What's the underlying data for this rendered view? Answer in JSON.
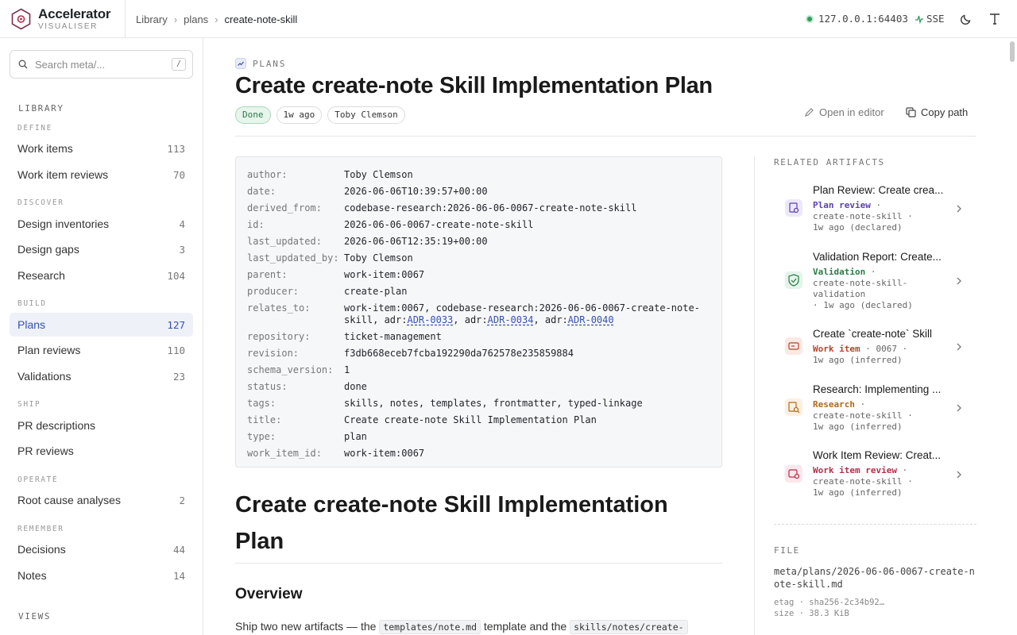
{
  "brand": {
    "name": "Accelerator",
    "subtitle": "VISUALISER"
  },
  "breadcrumb": {
    "items": [
      "Library",
      "plans"
    ],
    "current": "create-note-skill"
  },
  "server": {
    "address": "127.0.0.1:64403",
    "transport": "SSE",
    "status_color": "#2e9e5a"
  },
  "icons": {
    "logo": "hexagon-logo-icon",
    "theme": "moon-icon",
    "font": "text-size-icon"
  },
  "search": {
    "placeholder": "Search meta/...",
    "shortcut": "/"
  },
  "sidebar": {
    "title": "LIBRARY",
    "groups": [
      {
        "label": "DEFINE",
        "items": [
          {
            "label": "Work items",
            "count": "113"
          },
          {
            "label": "Work item reviews",
            "count": "70"
          }
        ]
      },
      {
        "label": "DISCOVER",
        "items": [
          {
            "label": "Design inventories",
            "count": "4"
          },
          {
            "label": "Design gaps",
            "count": "3"
          },
          {
            "label": "Research",
            "count": "104"
          }
        ]
      },
      {
        "label": "BUILD",
        "items": [
          {
            "label": "Plans",
            "count": "127",
            "active": true
          },
          {
            "label": "Plan reviews",
            "count": "110"
          },
          {
            "label": "Validations",
            "count": "23"
          }
        ]
      },
      {
        "label": "SHIP",
        "items": [
          {
            "label": "PR descriptions",
            "count": ""
          },
          {
            "label": "PR reviews",
            "count": ""
          }
        ]
      },
      {
        "label": "OPERATE",
        "items": [
          {
            "label": "Root cause analyses",
            "count": "2"
          }
        ]
      },
      {
        "label": "REMEMBER",
        "items": [
          {
            "label": "Decisions",
            "count": "44"
          },
          {
            "label": "Notes",
            "count": "14"
          }
        ]
      },
      {
        "label": "VIEWS",
        "items": []
      }
    ]
  },
  "doc": {
    "kicker": "PLANS",
    "title": "Create create-note Skill Implementation Plan",
    "chips": {
      "status": "Done",
      "age": "1w ago",
      "author": "Toby Clemson"
    },
    "actions": {
      "open": "Open in editor",
      "copy": "Copy path"
    },
    "frontmatter": [
      {
        "key": "author:",
        "value": "Toby Clemson"
      },
      {
        "key": "date:",
        "value": "2026-06-06T10:39:57+00:00"
      },
      {
        "key": "derived_from:",
        "value": "codebase-research:2026-06-06-0067-create-note-skill"
      },
      {
        "key": "id:",
        "value": "2026-06-06-0067-create-note-skill"
      },
      {
        "key": "last_updated:",
        "value": "2026-06-06T12:35:19+00:00"
      },
      {
        "key": "last_updated_by:",
        "value": "Toby Clemson"
      },
      {
        "key": "parent:",
        "value": "work-item:0067"
      },
      {
        "key": "producer:",
        "value": "create-plan"
      },
      {
        "key": "relates_to:",
        "value": "work-item:0067, codebase-research:2026-06-06-0067-create-note-skill, adr:ADR-0033, adr:ADR-0034, adr:ADR-0040"
      },
      {
        "key": "repository:",
        "value": "ticket-management"
      },
      {
        "key": "revision:",
        "value": "f3db668eceb7fcba192290da762578e235859884"
      },
      {
        "key": "schema_version:",
        "value": "1"
      },
      {
        "key": "status:",
        "value": "done"
      },
      {
        "key": "tags:",
        "value": "skills, notes, templates, frontmatter, typed-linkage"
      },
      {
        "key": "title:",
        "value": "Create create-note Skill Implementation Plan"
      },
      {
        "key": "type:",
        "value": "plan"
      },
      {
        "key": "work_item_id:",
        "value": "work-item:0067"
      }
    ],
    "relates_to_parts": {
      "prefix1": "work-item:0067, codebase-research:2026-06-06-0067-create-note-skill, adr:",
      "link1": "ADR-0033",
      "mid1": ", adr:",
      "link2": "ADR-0034",
      "mid2": ", adr:",
      "link3": "ADR-0040"
    },
    "body_title": "Create create-note Skill Implementation Plan",
    "section": "Overview",
    "para": {
      "text1": "Ship two new artifacts — the ",
      "code1": "templates/note.md",
      "text2": " template and the ",
      "code2": "skills/notes/create-"
    }
  },
  "related": {
    "title": "RELATED ARTIFACTS",
    "items": [
      {
        "title": "Plan Review: Create crea...",
        "type": "Plan review",
        "type_color": "#5b3fb0",
        "detail": "create-note-skill ·",
        "age": "1w ago (declared)",
        "icon": "plan-review-icon",
        "icon_bg": "#ede8fa"
      },
      {
        "title": "Validation Report: Create...",
        "type": "Validation",
        "type_color": "#2b7a47",
        "detail": "create-note-skill-validation",
        "age": "· 1w ago (declared)",
        "icon": "shield-check-icon",
        "icon_bg": "#e4f4ea"
      },
      {
        "title": "Create `create-note` Skill",
        "type": "Work item",
        "type_color": "#b5452a",
        "detail": "0067 ·",
        "age": "1w ago (inferred)",
        "icon": "ticket-icon",
        "icon_bg": "#fbe9e4"
      },
      {
        "title": "Research: Implementing ...",
        "type": "Research",
        "type_color": "#b06a1a",
        "detail": "create-note-skill ·",
        "age": "1w ago (inferred)",
        "icon": "research-icon",
        "icon_bg": "#fbf0e2"
      },
      {
        "title": "Work Item Review: Creat...",
        "type": "Work item review",
        "type_color": "#b0304a",
        "detail": "create-note-skill ·",
        "age": "1w ago (inferred)",
        "icon": "review-icon",
        "icon_bg": "#fbe6eb"
      }
    ]
  },
  "file": {
    "title": "FILE",
    "path": "meta/plans/2026-06-06-0067-create-note-skill.md",
    "etag": "etag · sha256-2c34b92…",
    "size": "size · 38.3 KiB"
  }
}
